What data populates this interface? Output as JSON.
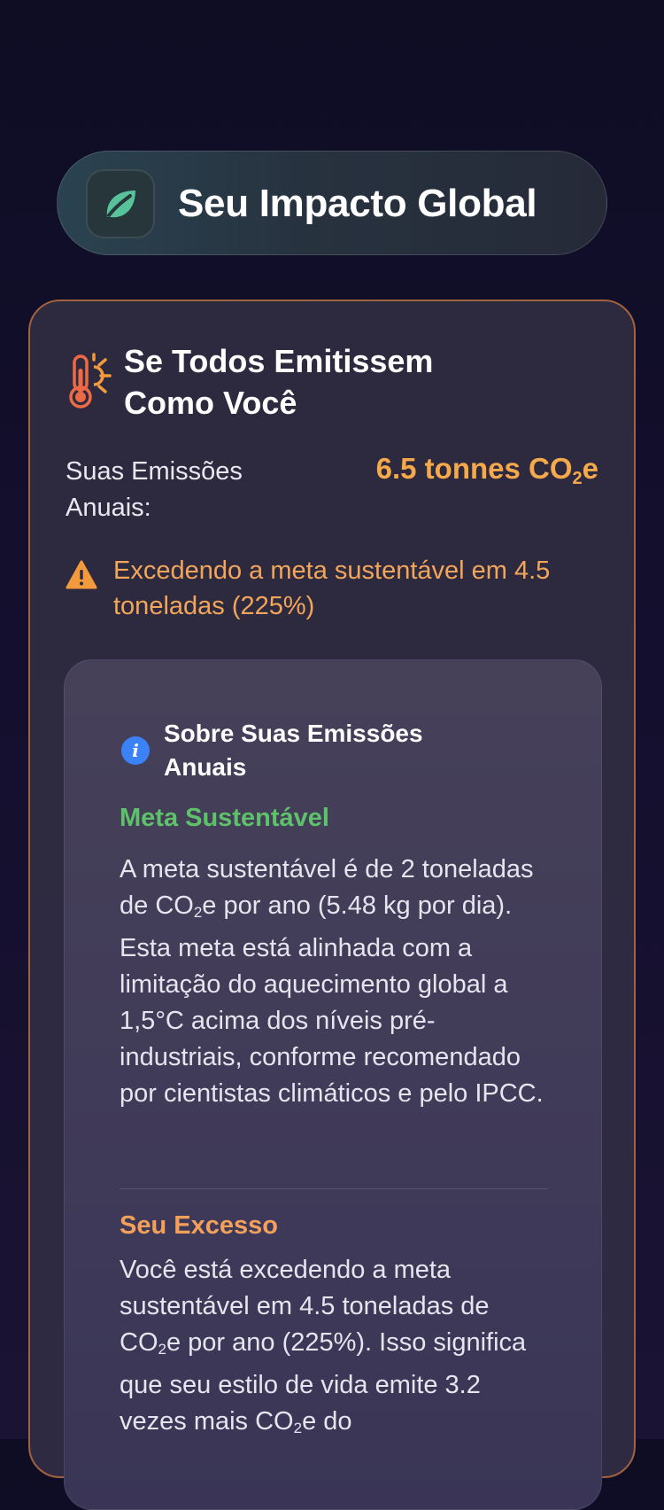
{
  "header": {
    "title": "Seu Impacto Global",
    "icon": "leaf-icon"
  },
  "card": {
    "title": "Se Todos Emitissem Como Você",
    "emissions_label": "Suas Emissões Anuais:",
    "emissions_value_main": "6.5 tonnes CO",
    "emissions_value_sub": "2",
    "emissions_value_tail": "e",
    "warning_text": "Excedendo a meta sustentável em 4.5 toneladas (225%)"
  },
  "info": {
    "title": "Sobre Suas Emissões Anuais",
    "sections": [
      {
        "heading": "Meta Sustentável",
        "body_a": "A meta sustentável é de 2 toneladas de CO",
        "body_sub": "2",
        "body_b": "e por ano (5.48 kg por dia). Esta meta está alinhada com a limitação do aquecimento global a 1,5°C acima dos níveis pré-industriais, conforme recomendado por cientistas climáticos e pelo IPCC."
      },
      {
        "heading": "Seu Excesso",
        "body_a": "Você está excedendo a meta sustentável em 4.5 toneladas de CO",
        "body_sub": "2",
        "body_b": "e por ano (225%). Isso significa que seu estilo de vida emite 3.2 vezes mais CO",
        "body_sub2": "2",
        "body_c": "e do"
      }
    ]
  },
  "colors": {
    "accent_orange": "#f5a94a",
    "success_green": "#5ec26a",
    "excess_orange": "#f2a05a",
    "info_blue": "#3b82f6",
    "card_border": "#a0623f"
  }
}
